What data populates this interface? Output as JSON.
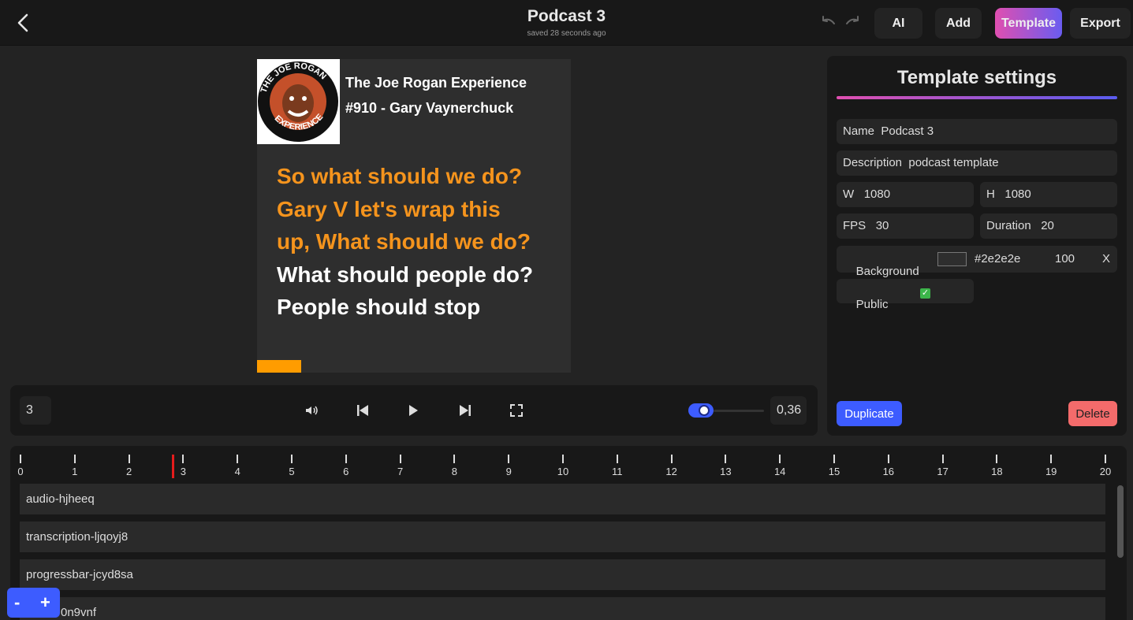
{
  "header": {
    "title": "Podcast 3",
    "saved": "saved 28 seconds ago",
    "buttons": {
      "ai": "AI",
      "add": "Add",
      "template": "Template",
      "export": "Export"
    }
  },
  "preview": {
    "title_line1": "The Joe Rogan Experience",
    "title_line2": "#910 - Gary Vaynerchuck",
    "logo_text": "THE JOE ROGAN EXPERIENCE",
    "transcript_highlight": [
      "So what should we do?",
      "Gary V let's wrap this",
      "up, What should we do?"
    ],
    "transcript_normal": [
      "What should people do?",
      "People should stop"
    ],
    "progress": 0.14,
    "colors": {
      "background": "#2e2e2e",
      "highlight": "#f5941d",
      "progress": "#ff9c00"
    }
  },
  "controls": {
    "frame": "3",
    "zoom": "0,36",
    "icons": [
      "volume-icon",
      "skip-back-icon",
      "play-icon",
      "skip-forward-icon",
      "fullscreen-icon"
    ]
  },
  "settings": {
    "title": "Template settings",
    "name_label": "Name",
    "name_value": "Podcast 3",
    "description_label": "Description",
    "description_value": "podcast template",
    "w_label": "W",
    "w_value": "1080",
    "h_label": "H",
    "h_value": "1080",
    "fps_label": "FPS",
    "fps_value": "30",
    "duration_label": "Duration",
    "duration_value": "20",
    "background_label": "Background",
    "background_color": "#2e2e2e",
    "background_opacity": "100",
    "background_clear": "X",
    "public_label": "Public",
    "public_checked": true,
    "duplicate": "Duplicate",
    "delete": "Delete"
  },
  "timeline": {
    "ticks": [
      "0",
      "1",
      "2",
      "3",
      "4",
      "5",
      "6",
      "7",
      "8",
      "9",
      "10",
      "11",
      "12",
      "13",
      "14",
      "15",
      "16",
      "17",
      "18",
      "19",
      "20"
    ],
    "playhead_seconds": 2.8,
    "tracks": [
      "audio-hjheeq",
      "transcription-ljqoyj8",
      "progressbar-jcyd8sa",
      "0n9vnf"
    ],
    "zoom_minus": "-",
    "zoom_plus": "+"
  }
}
